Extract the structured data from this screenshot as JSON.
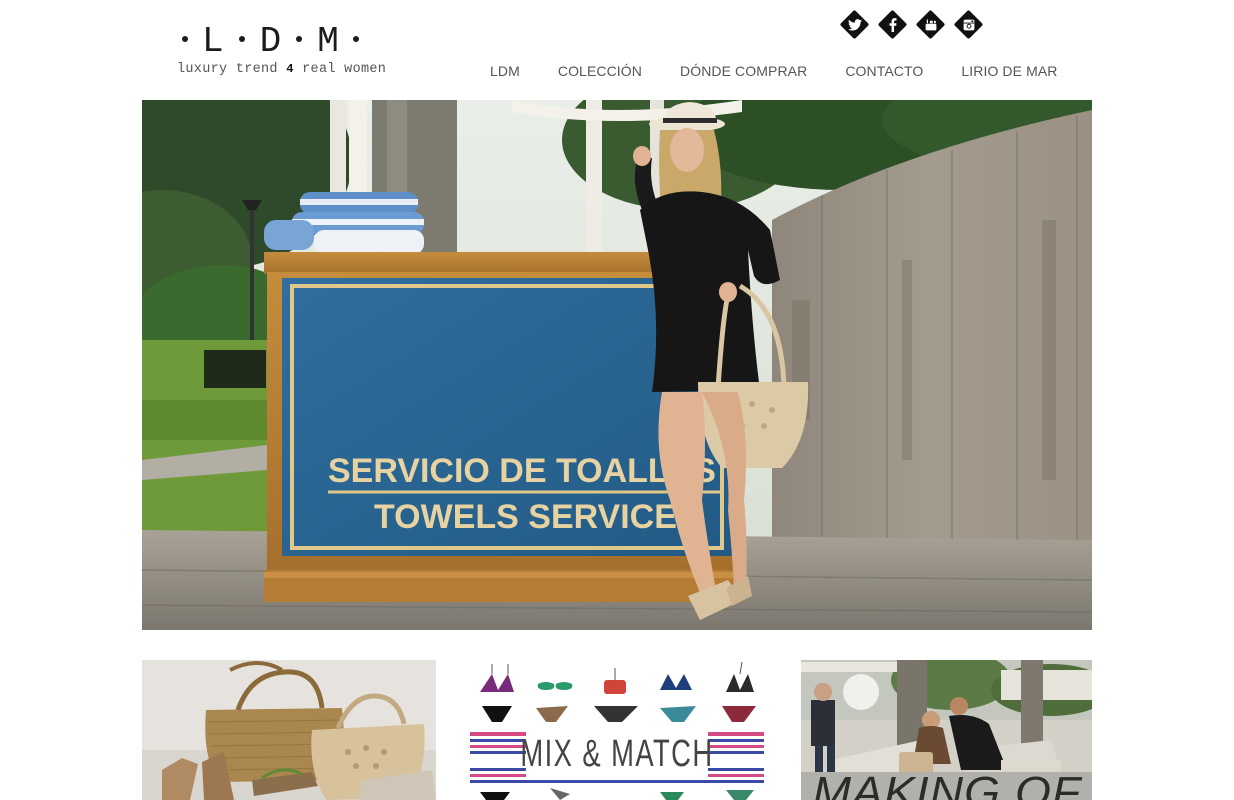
{
  "brand": {
    "letters": [
      "L",
      "D",
      "M"
    ],
    "tagline_pre": "luxury trend",
    "tagline_num": "4",
    "tagline_post": "real women"
  },
  "social": [
    {
      "name": "twitter",
      "glyph": "t"
    },
    {
      "name": "facebook",
      "glyph": "f"
    },
    {
      "name": "youtube",
      "glyph": "▶"
    },
    {
      "name": "instagram",
      "glyph": "◙"
    }
  ],
  "nav": {
    "items": [
      "LDM",
      "COLECCIÓN",
      "DÓNDE COMPRAR",
      "CONTACTO",
      "LIRIO DE MAR"
    ]
  },
  "hero": {
    "sign_line1": "SERVICIO DE TOALLAS",
    "sign_line2": "TOWELS SERVICE"
  },
  "tiles": {
    "mix_match": "MIX & MATCH",
    "making_of": "MAKING OF"
  },
  "colors": {
    "text_dark": "#1c1c1c",
    "nav_text": "#555555",
    "sign_blue": "#2f6e9e",
    "sign_gold": "#e0c88a"
  }
}
